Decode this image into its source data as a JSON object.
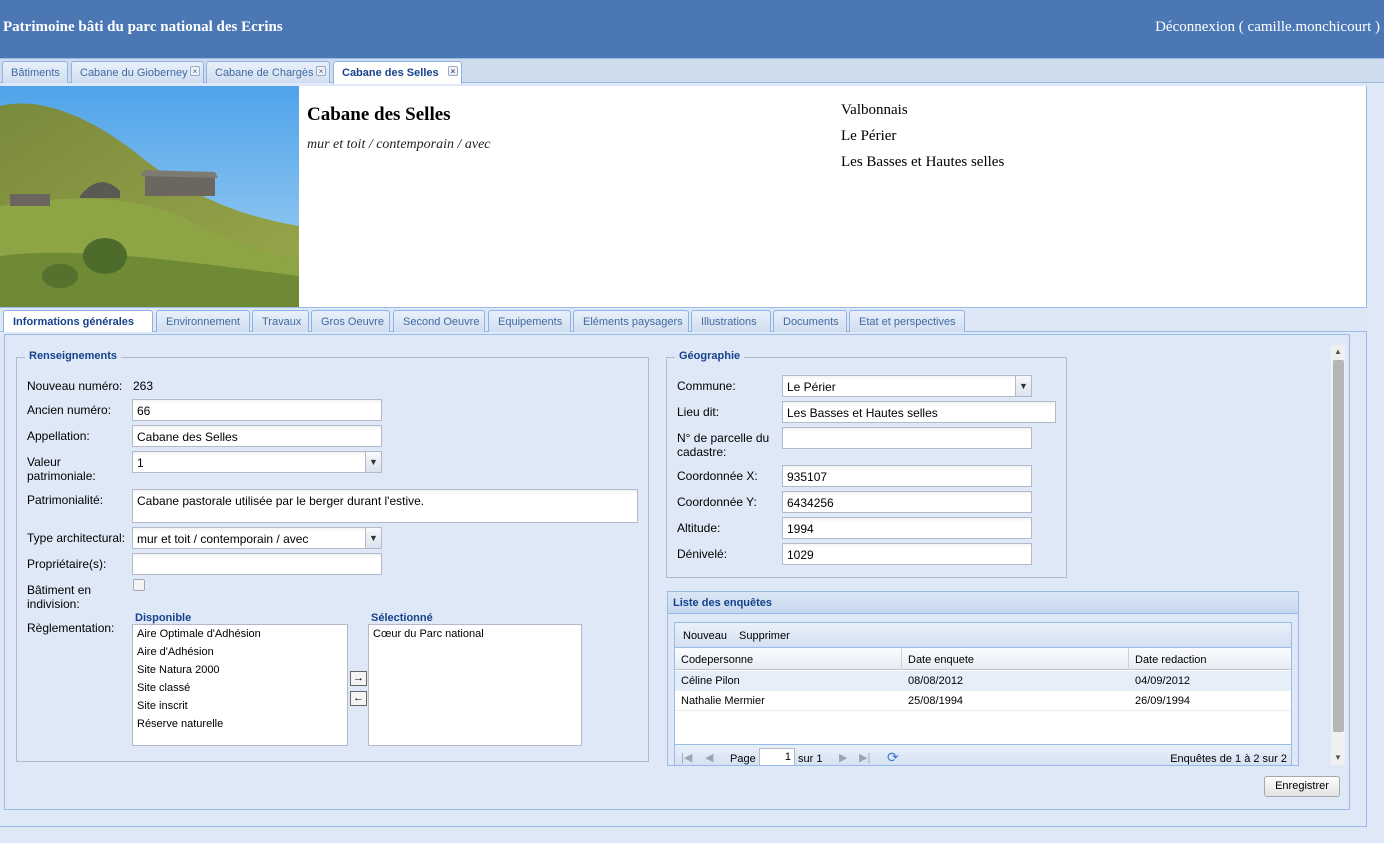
{
  "header": {
    "app_title": "Patrimoine bâti du parc national des Ecrins",
    "logout_label": "Déconnexion ( camille.monchicourt )"
  },
  "top_tabs": [
    {
      "label": "Bâtiments",
      "closable": false,
      "active": false
    },
    {
      "label": "Cabane du Gioberney",
      "closable": true,
      "active": false
    },
    {
      "label": "Cabane de Chargès",
      "closable": true,
      "active": false
    },
    {
      "label": "Cabane des Selles",
      "closable": true,
      "active": true
    }
  ],
  "summary": {
    "name": "Cabane des Selles",
    "type_line": "mur et toit / contemporain / avec",
    "locations": [
      "Valbonnais",
      "Le Périer",
      "Les Basses et Hautes selles"
    ]
  },
  "sub_tabs": [
    {
      "label": "Informations générales",
      "active": true
    },
    {
      "label": "Environnement"
    },
    {
      "label": "Travaux"
    },
    {
      "label": "Gros Oeuvre"
    },
    {
      "label": "Second Oeuvre"
    },
    {
      "label": "Equipements"
    },
    {
      "label": "Eléments paysagers"
    },
    {
      "label": "Illustrations"
    },
    {
      "label": "Documents"
    },
    {
      "label": "Etat et perspectives"
    }
  ],
  "renseignements": {
    "legend": "Renseignements",
    "nouveau_numero_label": "Nouveau numéro:",
    "nouveau_numero": "263",
    "ancien_numero_label": "Ancien numéro:",
    "ancien_numero": "66",
    "appellation_label": "Appellation:",
    "appellation": "Cabane des Selles",
    "valeur_label_1": "Valeur",
    "valeur_label_2": "patrimoniale:",
    "valeur": "1",
    "patrimonialite_label": "Patrimonialité:",
    "patrimonialite": "Cabane pastorale utilisée par le berger durant l'estive.",
    "type_label": "Type architectural:",
    "type": "mur et toit / contemporain / avec",
    "proprietaires_label": "Propriétaire(s):",
    "proprietaires": "",
    "indivision_label_1": "Bâtiment en",
    "indivision_label_2": "indivision:",
    "indivision_checked": false,
    "reglementation_label": "Règlementation:",
    "disponible_title": "Disponible",
    "disponible": [
      "Aire Optimale d'Adhésion",
      "Aire d'Adhésion",
      "Site Natura 2000",
      "Site classé",
      "Site inscrit",
      "Réserve naturelle"
    ],
    "selectionne_title": "Sélectionné",
    "selectionne": [
      "Cœur du Parc national"
    ]
  },
  "geographie": {
    "legend": "Géographie",
    "commune_label": "Commune:",
    "commune": "Le Périer",
    "lieu_dit_label": "Lieu dit:",
    "lieu_dit": "Les Basses et Hautes selles",
    "parcelle_label_1": "N° de parcelle du",
    "parcelle_label_2": "cadastre:",
    "parcelle": "",
    "coord_x_label": "Coordonnée X:",
    "coord_x": "935107",
    "coord_y_label": "Coordonnée Y:",
    "coord_y": "6434256",
    "altitude_label": "Altitude:",
    "altitude": "1994",
    "denivele_label": "Dénivelé:",
    "denivele": "1029"
  },
  "enquetes": {
    "title": "Liste des enquêtes",
    "toolbar": {
      "new_label": "Nouveau",
      "delete_label": "Supprimer"
    },
    "columns": [
      "Codepersonne",
      "Date enquete",
      "Date redaction"
    ],
    "rows": [
      [
        "Céline Pilon",
        "08/08/2012",
        "04/09/2012"
      ],
      [
        "Nathalie Mermier",
        "25/08/1994",
        "26/09/1994"
      ]
    ],
    "pager": {
      "page_label": "Page",
      "page": "1",
      "of_label": "sur 1",
      "summary": "Enquêtes de 1 à 2 sur 2"
    }
  },
  "save_label": "Enregistrer"
}
